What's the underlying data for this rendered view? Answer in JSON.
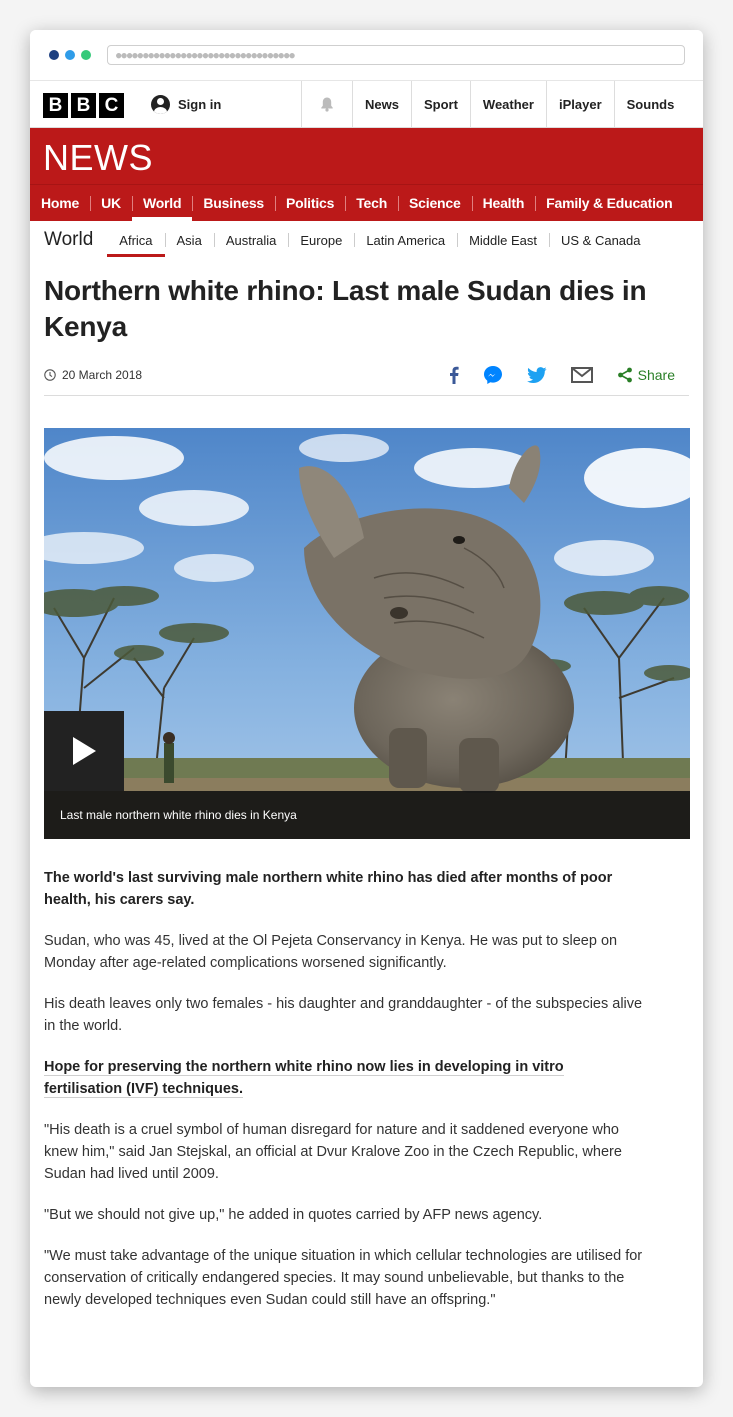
{
  "browser": {
    "url_placeholder": "●●●●●●●●●●●●●●●●●●●●●●●●●●●●●●●●●",
    "dot_colors": [
      "#1c3f80",
      "#2f9ce8",
      "#36c97a"
    ]
  },
  "topbar": {
    "logo_letters": [
      "B",
      "B",
      "C"
    ],
    "sign_in": "Sign in",
    "nav": [
      "News",
      "Sport",
      "Weather",
      "iPlayer",
      "Sounds"
    ]
  },
  "news_banner": {
    "title": "NEWS",
    "color": "#bb1919"
  },
  "main_nav": {
    "items": [
      "Home",
      "UK",
      "World",
      "Business",
      "Politics",
      "Tech",
      "Science",
      "Health",
      "Family & Education"
    ],
    "active": "World"
  },
  "sub_nav": {
    "title": "World",
    "items": [
      "Africa",
      "Asia",
      "Australia",
      "Europe",
      "Latin America",
      "Middle East",
      "US & Canada"
    ],
    "active": "Africa"
  },
  "article": {
    "headline": "Northern white rhino: Last male Sudan dies in Kenya",
    "date": "20 March 2018",
    "share_label": "Share",
    "share_icons": [
      "facebook-icon",
      "messenger-icon",
      "twitter-icon",
      "email-icon",
      "share-icon"
    ],
    "video_caption": "Last male northern white rhino dies in Kenya",
    "paragraphs": {
      "intro": "The world's last surviving male northern white rhino has died after months of poor health, his carers say.",
      "p1": "Sudan, who was 45, lived at the Ol Pejeta Conservancy in Kenya. He was put to sleep on Monday after age-related complications worsened significantly.",
      "p2": "His death leaves only two females - his daughter and granddaughter - of the subspecies alive in the world.",
      "link": "Hope for preserving the northern white rhino now lies in developing in vitro fertilisation (IVF) techniques.",
      "p3": "\"His death is a cruel symbol of human disregard for nature and it saddened everyone who knew him,\" said Jan Stejskal, an official at Dvur Kralove Zoo in the Czech Republic, where Sudan had lived until 2009.",
      "p4": "\"But we should not give up,\" he added in quotes carried by AFP news agency.",
      "p5": "\"We must take advantage of the unique situation in which cellular technologies are utilised for conservation of critically endangered species. It may sound unbelievable, but thanks to the newly developed techniques even Sudan could still have an offspring.\""
    }
  }
}
